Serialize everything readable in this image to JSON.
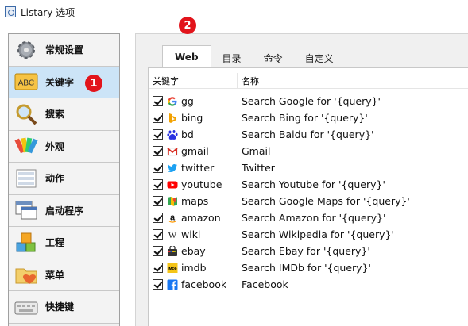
{
  "window": {
    "title": "Listary 选项"
  },
  "sidebar": {
    "items": [
      {
        "label": "常规设置",
        "icon": "gear-icon"
      },
      {
        "label": "关键字",
        "icon": "abc-icon",
        "active": true
      },
      {
        "label": "搜索",
        "icon": "magnifier-icon"
      },
      {
        "label": "外观",
        "icon": "palette-icon"
      },
      {
        "label": "动作",
        "icon": "actions-icon"
      },
      {
        "label": "启动程序",
        "icon": "windows-icon"
      },
      {
        "label": "工程",
        "icon": "cubes-icon"
      },
      {
        "label": "菜单",
        "icon": "folder-heart-icon"
      },
      {
        "label": "快捷键",
        "icon": "keyboard-icon"
      }
    ]
  },
  "tabs": [
    {
      "label": "Web",
      "active": true
    },
    {
      "label": "目录"
    },
    {
      "label": "命令"
    },
    {
      "label": "自定义"
    }
  ],
  "list": {
    "headers": {
      "keyword": "关键字",
      "name": "名称"
    },
    "rows": [
      {
        "key": "gg",
        "name": "Search Google for '{query}'",
        "icon": "google-icon",
        "checked": true
      },
      {
        "key": "bing",
        "name": "Search Bing for '{query}'",
        "icon": "bing-icon",
        "checked": true
      },
      {
        "key": "bd",
        "name": "Search Baidu for '{query}'",
        "icon": "baidu-icon",
        "checked": true
      },
      {
        "key": "gmail",
        "name": "Gmail",
        "icon": "gmail-icon",
        "checked": true
      },
      {
        "key": "twitter",
        "name": "Twitter",
        "icon": "twitter-icon",
        "checked": true
      },
      {
        "key": "youtube",
        "name": "Search Youtube for '{query}'",
        "icon": "youtube-icon",
        "checked": true
      },
      {
        "key": "maps",
        "name": "Search Google Maps for '{query}'",
        "icon": "maps-icon",
        "checked": true
      },
      {
        "key": "amazon",
        "name": "Search Amazon for '{query}'",
        "icon": "amazon-icon",
        "checked": true
      },
      {
        "key": "wiki",
        "name": "Search Wikipedia for '{query}'",
        "icon": "wikipedia-icon",
        "checked": true
      },
      {
        "key": "ebay",
        "name": "Search Ebay for '{query}'",
        "icon": "ebay-icon",
        "checked": true
      },
      {
        "key": "imdb",
        "name": "Search IMDb for '{query}'",
        "icon": "imdb-icon",
        "checked": true
      },
      {
        "key": "facebook",
        "name": "Facebook",
        "icon": "facebook-icon",
        "checked": true
      }
    ]
  },
  "annotations": {
    "badge1": "1",
    "badge2": "2"
  },
  "colors": {
    "active_item": "#cce4f7",
    "badge": "#e2141b"
  }
}
